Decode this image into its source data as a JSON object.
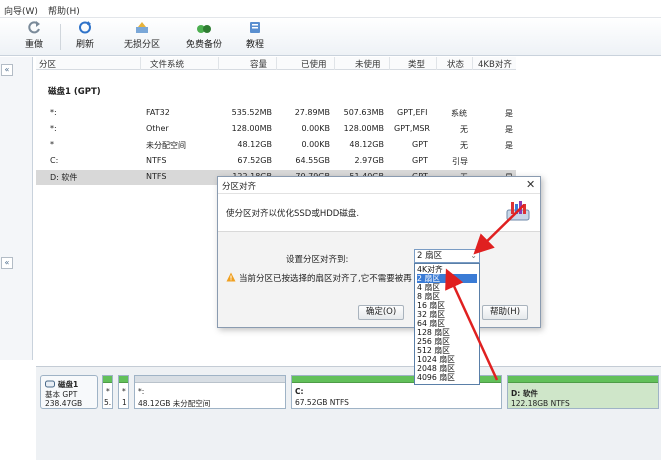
{
  "menu": {
    "items": [
      "向导(W)",
      "帮助(H)"
    ]
  },
  "toolbar": {
    "undo": "重做",
    "refresh": "刷新",
    "lossless": "无损分区",
    "backup": "免费备份",
    "tutorial": "教程"
  },
  "table": {
    "headers": [
      "分区",
      "文件系统",
      "容量",
      "已使用",
      "未使用",
      "类型",
      "状态",
      "4KB对齐"
    ],
    "disk_title": "磁盘1 (GPT)",
    "rows": [
      {
        "name": "*:",
        "fs": "FAT32",
        "cap": "535.52MB",
        "used": "27.89MB",
        "free": "507.63MB",
        "type": "GPT,EFI",
        "status": "系统",
        "align": "是"
      },
      {
        "name": "*:",
        "fs": "Other",
        "cap": "128.00MB",
        "used": "0.00KB",
        "free": "128.00MB",
        "type": "GPT,MSR",
        "status": "无",
        "align": "是"
      },
      {
        "name": "*",
        "fs": "未分配空间",
        "cap": "48.12GB",
        "used": "0.00KB",
        "free": "48.12GB",
        "type": "GPT",
        "status": "无",
        "align": "是"
      },
      {
        "name": "C:",
        "fs": "NTFS",
        "cap": "67.52GB",
        "used": "64.55GB",
        "free": "2.97GB",
        "type": "GPT",
        "status": "引导",
        "align": ""
      },
      {
        "name": "D: 软件",
        "fs": "NTFS",
        "cap": "122.18GB",
        "used": "70.79GB",
        "free": "51.40GB",
        "type": "GPT",
        "status": "无",
        "align": "是"
      }
    ]
  },
  "diskmap": {
    "disk_label": "磁盘1",
    "disk_type": "基本 GPT",
    "disk_size": "238.47GB",
    "p1_a": "*",
    "p1_b": "5.",
    "p2_a": "*",
    "p2_b": "1",
    "unalloc_name": "*:",
    "unalloc_desc": "48.12GB 未分配空间",
    "c_name": "C:",
    "c_desc": "67.52GB NTFS",
    "d_name": "D: 软件",
    "d_desc": "122.18GB NTFS"
  },
  "dialog": {
    "title": "分区对齐",
    "description": "使分区对齐以优化SSD或HDD磁盘.",
    "setting_label": "设置分区对齐到:",
    "selected": "2 扇区",
    "warning": "当前分区已按选择的扇区对齐了,它不需要被再",
    "ok": "确定(O)",
    "help": "帮助(H)",
    "options": [
      "4K对齐",
      "2 扇区",
      "4 扇区",
      "8 扇区",
      "16 扇区",
      "32 扇区",
      "64 扇区",
      "128 扇区",
      "256 扇区",
      "512 扇区",
      "1024 扇区",
      "2048 扇区",
      "4096 扇区"
    ]
  },
  "colors": {
    "accent": "#3a7bd5",
    "partition_green": "#62c05a",
    "arrow_red": "#e02020"
  }
}
